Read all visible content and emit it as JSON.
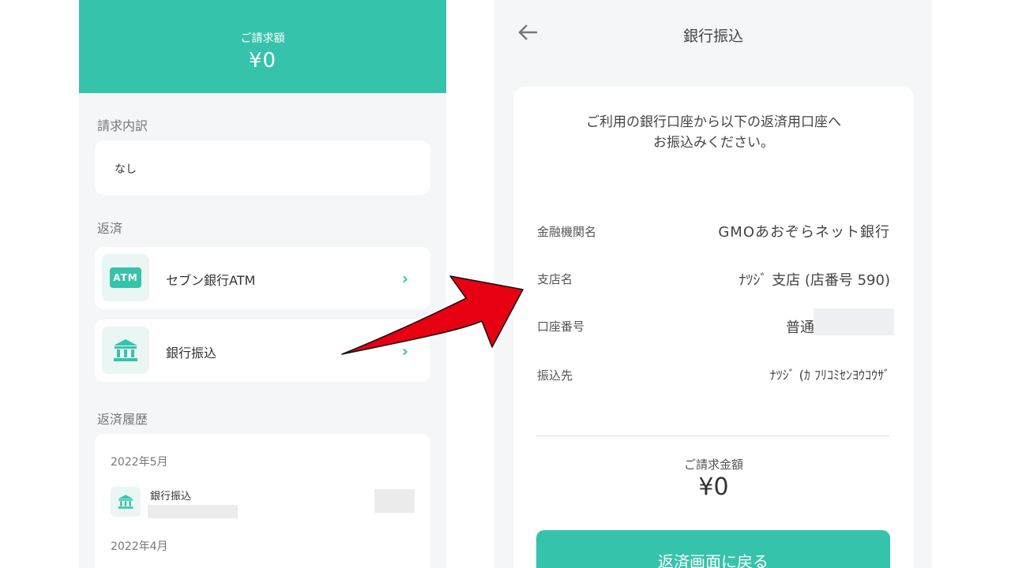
{
  "left": {
    "header": {
      "label": "ご請求額",
      "amount": "¥0"
    },
    "breakdown": {
      "section_label": "請求内訳",
      "value": "なし"
    },
    "repayment": {
      "section_label": "返済",
      "items": [
        {
          "icon": "atm-icon",
          "icon_text": "ATM",
          "label": "セブン銀行ATM"
        },
        {
          "icon": "bank-icon",
          "label": "銀行振込"
        }
      ]
    },
    "history": {
      "section_label": "返済履歴",
      "months": [
        {
          "month": "2022年5月",
          "entries": [
            {
              "icon": "bank-icon",
              "title": "銀行振込"
            }
          ]
        },
        {
          "month": "2022年4月"
        }
      ]
    }
  },
  "right": {
    "title": "銀行振込",
    "instruction_line1": "ご利用の銀行口座から以下の返済用口座へ",
    "instruction_line2": "お振込みください。",
    "fields": [
      {
        "label": "金融機関名",
        "value": "GMOあおぞらネット銀行"
      },
      {
        "label": "支店名",
        "value": "ﾅﾂｼﾞ 支店 (店番号 590)"
      },
      {
        "label": "口座番号",
        "value": "普通"
      },
      {
        "label": "振込先",
        "value": "ﾅﾂｼﾞ (ｶ ﾌﾘｺﾐｾﾝﾖｳｺｳｻﾞ"
      }
    ],
    "due_label": "ご請求金額",
    "due_amount": "¥0",
    "return_button": "返済画面に戻る"
  },
  "colors": {
    "accent": "#36c3ab",
    "arrow": "#e60012",
    "background": "#f5f6f8"
  }
}
